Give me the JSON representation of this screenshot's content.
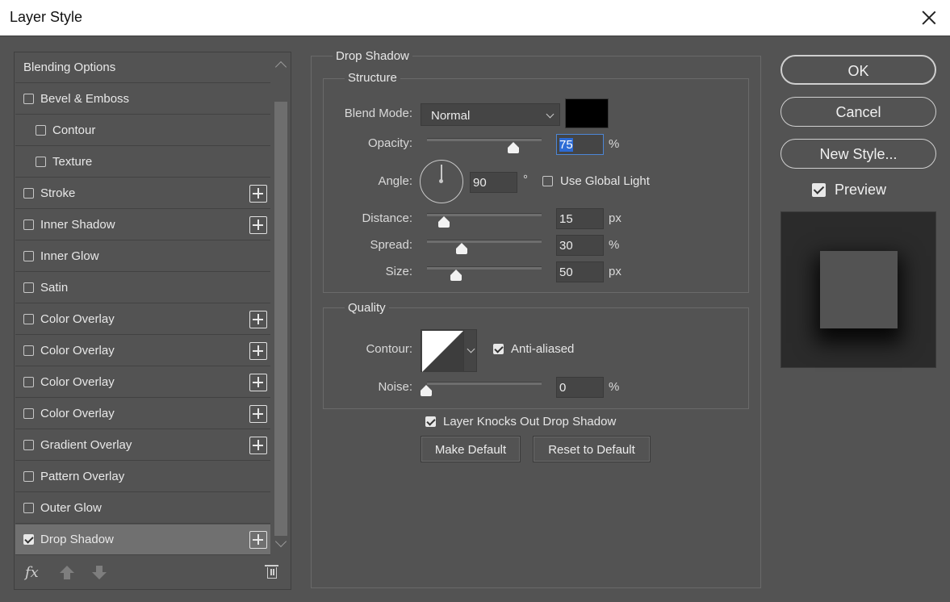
{
  "window": {
    "title": "Layer Style"
  },
  "styles": [
    {
      "label": "Blending Options",
      "checkbox": false,
      "checked": false,
      "indent": false,
      "plus": false,
      "selected": false
    },
    {
      "label": "Bevel & Emboss",
      "checkbox": true,
      "checked": false,
      "indent": false,
      "plus": false,
      "selected": false
    },
    {
      "label": "Contour",
      "checkbox": true,
      "checked": false,
      "indent": true,
      "plus": false,
      "selected": false
    },
    {
      "label": "Texture",
      "checkbox": true,
      "checked": false,
      "indent": true,
      "plus": false,
      "selected": false
    },
    {
      "label": "Stroke",
      "checkbox": true,
      "checked": false,
      "indent": false,
      "plus": true,
      "selected": false
    },
    {
      "label": "Inner Shadow",
      "checkbox": true,
      "checked": false,
      "indent": false,
      "plus": true,
      "selected": false
    },
    {
      "label": "Inner Glow",
      "checkbox": true,
      "checked": false,
      "indent": false,
      "plus": false,
      "selected": false
    },
    {
      "label": "Satin",
      "checkbox": true,
      "checked": false,
      "indent": false,
      "plus": false,
      "selected": false
    },
    {
      "label": "Color Overlay",
      "checkbox": true,
      "checked": false,
      "indent": false,
      "plus": true,
      "selected": false
    },
    {
      "label": "Color Overlay",
      "checkbox": true,
      "checked": false,
      "indent": false,
      "plus": true,
      "selected": false
    },
    {
      "label": "Color Overlay",
      "checkbox": true,
      "checked": false,
      "indent": false,
      "plus": true,
      "selected": false
    },
    {
      "label": "Color Overlay",
      "checkbox": true,
      "checked": false,
      "indent": false,
      "plus": true,
      "selected": false
    },
    {
      "label": "Gradient Overlay",
      "checkbox": true,
      "checked": false,
      "indent": false,
      "plus": true,
      "selected": false
    },
    {
      "label": "Pattern Overlay",
      "checkbox": true,
      "checked": false,
      "indent": false,
      "plus": false,
      "selected": false
    },
    {
      "label": "Outer Glow",
      "checkbox": true,
      "checked": false,
      "indent": false,
      "plus": false,
      "selected": false
    },
    {
      "label": "Drop Shadow",
      "checkbox": true,
      "checked": true,
      "indent": false,
      "plus": true,
      "selected": true
    }
  ],
  "list_footer": {
    "fx_label": "fx"
  },
  "panel": {
    "title": "Drop Shadow",
    "structure": {
      "title": "Structure",
      "blend_mode_label": "Blend Mode:",
      "blend_mode_value": "Normal",
      "shadow_color": "#000000",
      "opacity_label": "Opacity:",
      "opacity_value": "75",
      "opacity_unit": "%",
      "opacity_level": 0.75,
      "angle_label": "Angle:",
      "angle_value": "90",
      "angle_unit": "°",
      "use_global_light_label": "Use Global Light",
      "use_global_light_checked": false,
      "distance_label": "Distance:",
      "distance_value": "15",
      "distance_unit": "px",
      "spread_label": "Spread:",
      "spread_value": "30",
      "spread_unit": "%",
      "size_label": "Size:",
      "size_value": "50",
      "size_unit": "px"
    },
    "quality": {
      "title": "Quality",
      "contour_label": "Contour:",
      "anti_aliased_label": "Anti-aliased",
      "anti_aliased_checked": true,
      "noise_label": "Noise:",
      "noise_value": "0",
      "noise_unit": "%"
    },
    "knockout_label": "Layer Knocks Out Drop Shadow",
    "knockout_checked": true,
    "make_default_label": "Make Default",
    "reset_default_label": "Reset to Default"
  },
  "actions": {
    "ok_label": "OK",
    "cancel_label": "Cancel",
    "new_style_label": "New Style...",
    "preview_label": "Preview",
    "preview_checked": true
  }
}
